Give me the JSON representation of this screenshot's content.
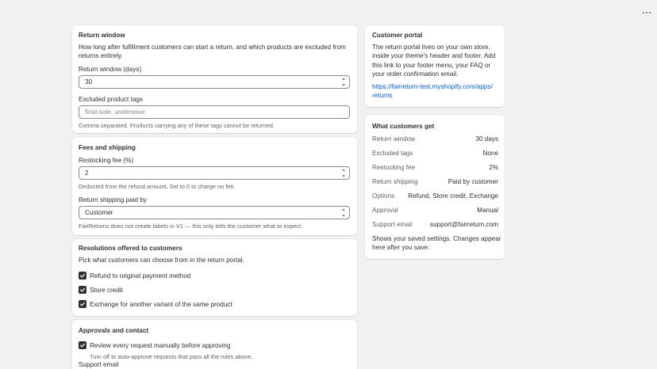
{
  "return_window": {
    "heading": "Return window",
    "description_line1": "How long after fulfillment customers can start a return, and which products are excluded from",
    "description_line2": "returns entirely.",
    "days_label": "Return window (days)",
    "days_value": "30",
    "tags_label": "Excluded product tags",
    "tags_placeholder": "final-sale, underwear",
    "tags_help": "Comma separated. Products carrying any of these tags cannot be returned."
  },
  "fees": {
    "heading": "Fees and shipping",
    "restocking_label": "Restocking fee (%)",
    "restocking_value": "2",
    "restocking_help": "Deducted from the refund amount. Set to 0 to charge no fee.",
    "shipping_label": "Return shipping paid by",
    "shipping_value": "Customer",
    "shipping_help": "FairReturns does not create labels in V1 — this only tells the customer what to expect."
  },
  "resolutions": {
    "heading": "Resolutions offered to customers",
    "description": "Pick what customers can choose from in the return portal.",
    "options": [
      {
        "label": "Refund to original payment method",
        "checked": true
      },
      {
        "label": "Store credit",
        "checked": true
      },
      {
        "label": "Exchange for another variant of the same product",
        "checked": true
      }
    ]
  },
  "approvals": {
    "heading": "Approvals and contact",
    "review_label": "Review every request manually before approving",
    "review_checked": true,
    "review_help": "Turn off to auto-approve requests that pass all the rules above.",
    "support_label": "Support email"
  },
  "portal": {
    "heading": "Customer portal",
    "lines": [
      "The return portal lives on your own store,",
      "inside your theme's header and footer. Add",
      "this link to your footer menu, your FAQ or",
      "your order confirmation email."
    ],
    "link_line1": "https://fairreturn-test.myshopify.com/apps/",
    "link_line2": "returns"
  },
  "summary": {
    "heading": "What customers get",
    "rows": [
      {
        "key": "Return window",
        "value": "30 days"
      },
      {
        "key": "Excluded tags",
        "value": "None"
      },
      {
        "key": "Restocking fee",
        "value": "2%"
      },
      {
        "key": "Return shipping",
        "value": "Paid by customer"
      },
      {
        "key": "Options",
        "value": "Refund, Store credit, Exchange"
      },
      {
        "key": "Approval",
        "value": "Manual"
      },
      {
        "key": "Support email",
        "value": "support@fairreturn.com"
      }
    ],
    "note_line1": "Shows your saved settings. Changes appear",
    "note_line2": "here after you save."
  },
  "icons": {
    "menu": "more-horizontal-icon",
    "checkbox": "checkmark-icon",
    "spinner": "stepper-icon",
    "select": "select-chevron-icon"
  },
  "colors": {
    "background": "#f1f1f1",
    "card": "#ffffff",
    "link": "#005bd3",
    "checkbox": "#303030"
  }
}
